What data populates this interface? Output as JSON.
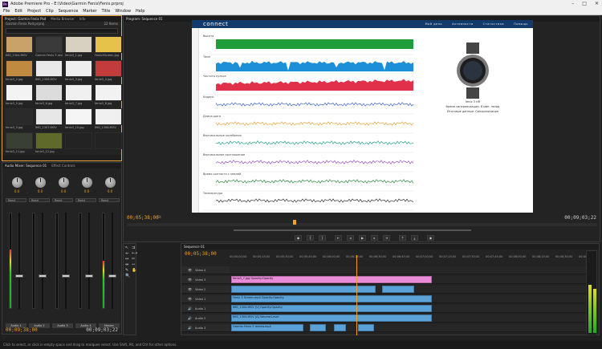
{
  "window": {
    "title": "Adobe Premiere Pro - E:\\Video\\Garmin Fenix\\Fenix.prproj",
    "app_icon": "Pr"
  },
  "menu": [
    "File",
    "Edit",
    "Project",
    "Clip",
    "Sequence",
    "Marker",
    "Title",
    "Window",
    "Help"
  ],
  "project_panel": {
    "tabs": [
      "Project: Garmin Fenix Pod",
      "Media Browser",
      "Info"
    ],
    "path": "Garmin Fenix Pod.prproj",
    "item_count": "22 Items",
    "thumbnails": [
      {
        "caption": "IMG_1304.MOV",
        "color": "#c9a26a"
      },
      {
        "caption": "Garmin Fenix 3 review.mp4",
        "color": "#3a3a3a"
      },
      {
        "caption": "fenix3_1.jpg",
        "color": "#d8d0c0"
      },
      {
        "caption": "Fenix3Screen.jpg",
        "color": "#e6c24a"
      },
      {
        "caption": "fenix3_2.jpg",
        "color": "#c08a40"
      },
      {
        "caption": "IMG_1306.MOV",
        "color": "#e9e9e9"
      },
      {
        "caption": "fenix3_3.jpg",
        "color": "#eeeeee"
      },
      {
        "caption": "fenix3_4.jpg",
        "color": "#c23c3c"
      },
      {
        "caption": "fenix3_5.jpg",
        "color": "#f3f3f3"
      },
      {
        "caption": "fenix3_6.jpg",
        "color": "#dcdcdc"
      },
      {
        "caption": "fenix3_7.jpg",
        "color": "#f0f0f0"
      },
      {
        "caption": "fenix3_8.jpg",
        "color": "#f2f2f2"
      },
      {
        "caption": "fenix3_9.jpg",
        "color": "#2a2a2a"
      },
      {
        "caption": "IMG_1307.MOV",
        "color": "#e7e7e7"
      },
      {
        "caption": "fenix3_10.jpg",
        "color": "#f5f5f5"
      },
      {
        "caption": "IMG_1308.MOV",
        "color": "#f0f0f0"
      },
      {
        "caption": "fenix3_11.jpg",
        "color": "#3a3f33"
      },
      {
        "caption": "fenix3_12.jpg",
        "color": "#5f6a2a"
      },
      {
        "caption": "",
        "color": "#232323"
      },
      {
        "caption": "",
        "color": "#232323"
      }
    ]
  },
  "audio_mixer": {
    "tabs": [
      "Audio Mixer: Sequence 01",
      "Effect Controls"
    ],
    "strips": [
      {
        "label": "Audio 1",
        "mode": "Read",
        "value": "0.0",
        "level": 0.62,
        "fader": 0.36
      },
      {
        "label": "Audio 2",
        "mode": "Read",
        "value": "0.0",
        "level": 0.0,
        "fader": 0.36
      },
      {
        "label": "Audio 3",
        "mode": "Read",
        "value": "0.0",
        "level": 0.0,
        "fader": 0.36
      },
      {
        "label": "Audio 4",
        "mode": "Read",
        "value": "0.0",
        "level": 0.0,
        "fader": 0.36
      },
      {
        "label": "Master",
        "mode": "Read",
        "value": "0.0",
        "level": 0.5,
        "fader": 0.36
      }
    ],
    "timecode": "00;09;38;00",
    "duration": "00;09;03;22"
  },
  "program_monitor": {
    "tab": "Program: Sequence 01",
    "timecode_in": "00;05;38;00",
    "fit": "Fit",
    "timecode_out": "00;09;03;22",
    "page": {
      "brand": "connect",
      "nav_links": [
        "Мой день",
        "Активности",
        "Статистика",
        "Помощь"
      ],
      "watch_caption": [
        "fenix 3 HR",
        "Время синхронизации: 8 мин. назад",
        "Итоговые данные: Синхронизация"
      ],
      "rows": [
        {
          "label": "Высота",
          "color": "#1f9d3a"
        },
        {
          "label": "Темп",
          "color": "#1d8fd8"
        },
        {
          "label": "Частота пульса",
          "color": "#e0304a"
        },
        {
          "label": "Каденс",
          "color": "#3a63c7"
        },
        {
          "label": "Длина шага",
          "color": "#e7a23a"
        },
        {
          "label": "Вертикальные колебания",
          "color": "#1fa08a"
        },
        {
          "label": "Вертикальное соотношение",
          "color": "#9b4dc8"
        },
        {
          "label": "Время контакта с землей",
          "color": "#2c8a3c"
        },
        {
          "label": "Температура",
          "color": "#333333"
        }
      ]
    }
  },
  "timeline": {
    "tab": "Sequence 01",
    "timecode": "00;05;38;00",
    "ruler": [
      "00;05;00;00",
      "00;05;15;00",
      "00;05;30;00",
      "00;05;45;00",
      "00;06;00;00",
      "00;06;15;00",
      "00;06;30;00",
      "00;06;45;00",
      "00;07;00;00",
      "00;07;15;00",
      "00;07;30;00",
      "00;07;45;00",
      "00;08;00;00",
      "00;08;15;00",
      "00;08;30;00",
      "00;08;45;00"
    ],
    "tracks": [
      {
        "name": "Video 4",
        "type": "video"
      },
      {
        "name": "Video 3",
        "type": "video"
      },
      {
        "name": "Video 2",
        "type": "video"
      },
      {
        "name": "Video 1",
        "type": "video"
      },
      {
        "name": "Audio 1",
        "type": "audio"
      },
      {
        "name": "Audio 2",
        "type": "audio"
      },
      {
        "name": "Audio 3",
        "type": "audio"
      }
    ],
    "clips": {
      "v3_label": "fenix3_7.jpg Opacity:Opacity",
      "v2_label": "Fenix 3 Screen.mp4 Opacity:Opacity",
      "v1_label": "IMG_1304.MOV [V] Opacity:Opacity",
      "a1_label": "IMG_1304.MOV [A] Volume:Level",
      "a2_label": "Garmin Fenix 3 review.mp4"
    }
  },
  "status": "Click to select, or click in empty space and drag to marquee select. Use Shift, Alt, and Ctrl for other options.",
  "colors": {
    "accent_orange": "#e8a33d",
    "pink_clip": "#e98bd8",
    "blue_clip": "#5aa2d8",
    "timecode": "#f0a01e"
  }
}
